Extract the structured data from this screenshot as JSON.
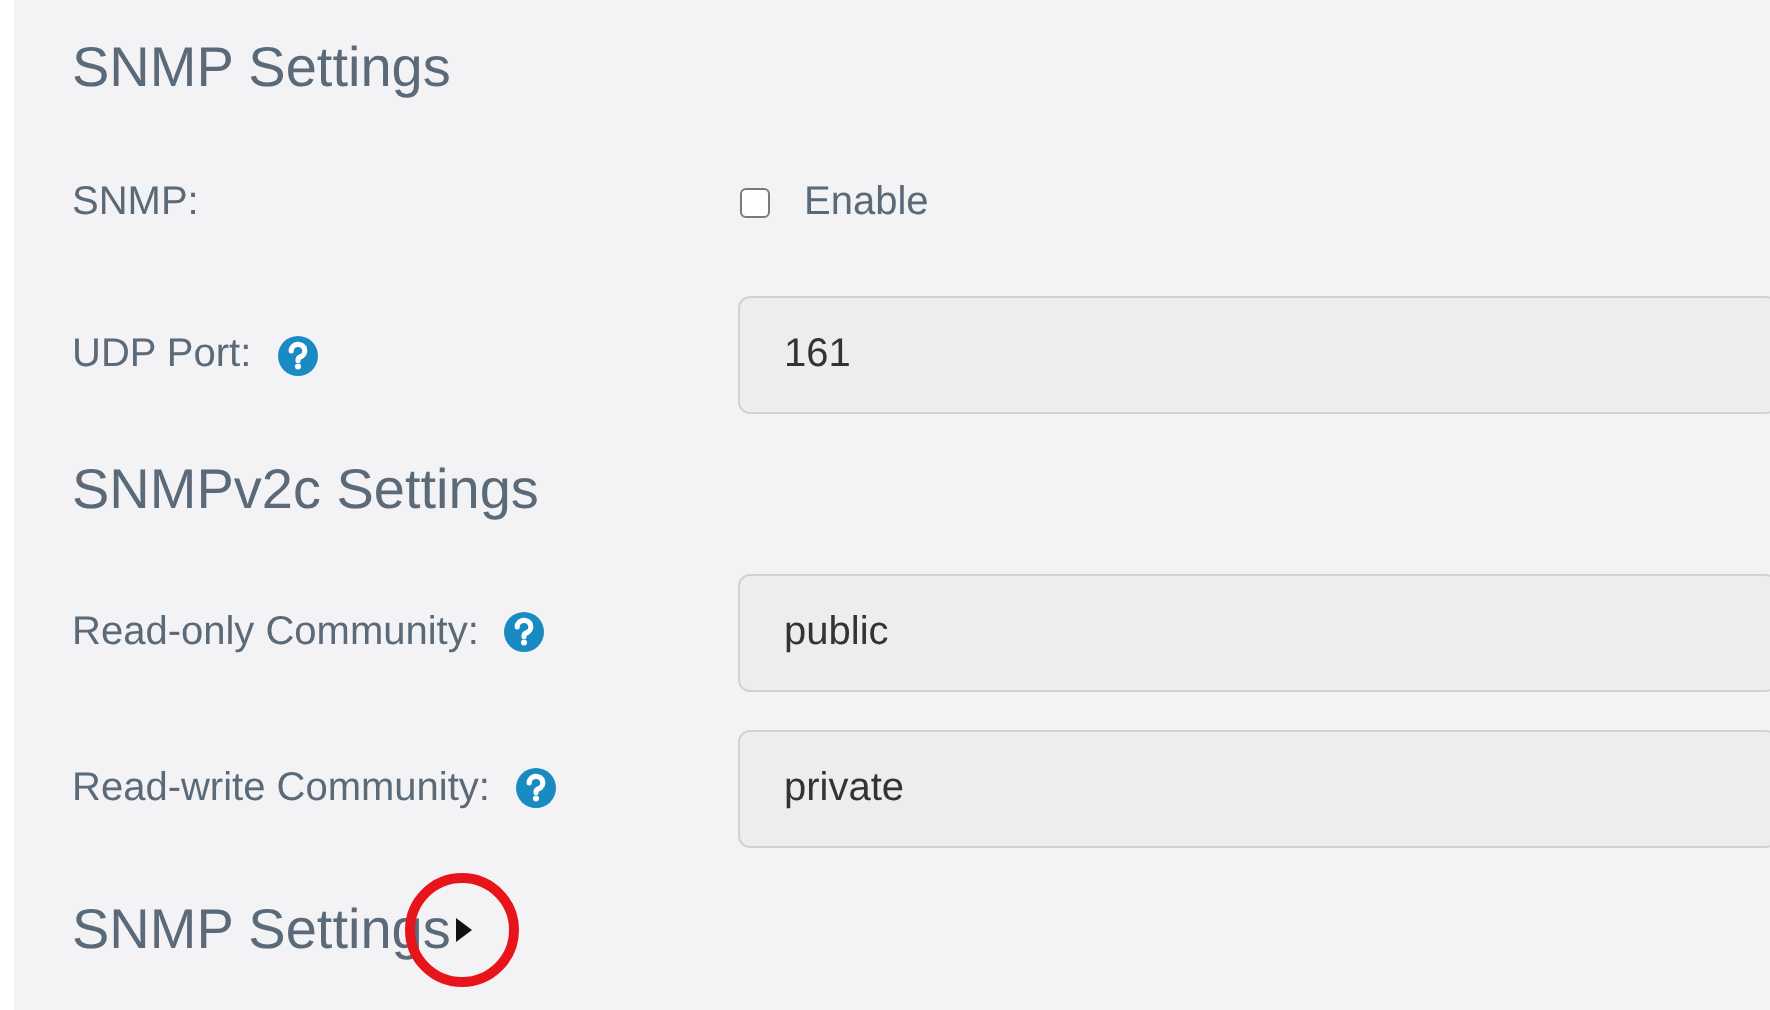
{
  "items": [
    {
      "kind": "heading",
      "text": "SNMP Settings"
    },
    {
      "kind": "checkbox",
      "label": "SNMP:",
      "option": "Enable",
      "checked": false
    },
    {
      "kind": "field",
      "label": "UDP Port:",
      "help": true,
      "value": "161"
    },
    {
      "kind": "heading",
      "text": "SNMPv2c Settings"
    },
    {
      "kind": "field",
      "label": "Read-only Community:",
      "help": true,
      "value": "public"
    },
    {
      "kind": "field",
      "label": "Read-write Community:",
      "help": true,
      "value": "private"
    },
    {
      "kind": "heading",
      "text": "SNMP Settings",
      "expanded": false,
      "circled": true
    }
  ]
}
